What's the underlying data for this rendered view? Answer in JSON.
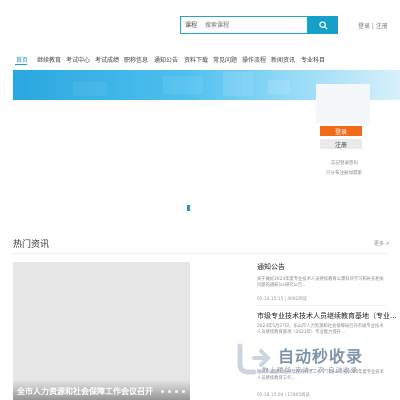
{
  "header": {
    "search": {
      "type_label": "课程",
      "placeholder": "搜索课程"
    },
    "login_link": "登录 | 注册"
  },
  "nav": {
    "items": [
      {
        "label": "首页",
        "active": true
      },
      {
        "label": "继续教育"
      },
      {
        "label": "考试中心"
      },
      {
        "label": "考试成绩"
      },
      {
        "label": "职称信息"
      },
      {
        "label": "通知公告"
      },
      {
        "label": "资料下载"
      },
      {
        "label": "常见问题"
      },
      {
        "label": "操作流程"
      },
      {
        "label": "新闻资讯"
      },
      {
        "label": "专业科目"
      }
    ]
  },
  "login_box": {
    "login_label": "登录",
    "register_label": "注册",
    "forgot_text": "忘记登录密码",
    "help_text": "只分布注册加盟家"
  },
  "news": {
    "section_title": "热门资讯",
    "more_label": "更多 >",
    "featured_caption": "全市人力资源和社会保障工作会议召开",
    "items": [
      {
        "title": "通知公告",
        "summary": "关于做好2024年度专业技术人员继续教育公需科目学习和补充相关问题的通知(sx研究公告...",
        "meta": "05-14 15:15  |  4092阅读"
      },
      {
        "title": "市级专业技术技术人员继续教育基地（专业...",
        "summary": "2023年5月27日，乐山市人力资源和社会保障局召开市级专业技术人员继续教育基地（2023年）专业能力提升...",
        "meta": "05-28 15:09  |  15905阅读"
      }
    ],
    "extra_summary": "做好市县级实施继续教育共享工作学习乐山市县2024年度专业技术人员继续教育工作..."
  },
  "watermark": {
    "title": "自动秒收录",
    "subtitle": "数上精华·来访一次·自动收录"
  },
  "colors": {
    "accent": "#17a0c7",
    "login_button": "#f26b1d"
  }
}
